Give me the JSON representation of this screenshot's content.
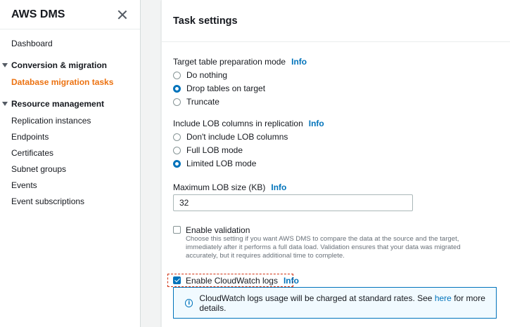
{
  "sidebar": {
    "title": "AWS DMS",
    "dashboard": "Dashboard",
    "section_conversion": "Conversion & migration",
    "db_migration_tasks": "Database migration tasks",
    "section_resource": "Resource management",
    "items": [
      "Replication instances",
      "Endpoints",
      "Certificates",
      "Subnet groups",
      "Events",
      "Event subscriptions"
    ]
  },
  "panel": {
    "title": "Task settings",
    "target_prep": {
      "label": "Target table preparation mode",
      "info": "Info",
      "options": [
        "Do nothing",
        "Drop tables on target",
        "Truncate"
      ],
      "selected": "Drop tables on target"
    },
    "lob": {
      "label": "Include LOB columns in replication",
      "info": "Info",
      "options": [
        "Don't include LOB columns",
        "Full LOB mode",
        "Limited LOB mode"
      ],
      "selected": "Limited LOB mode"
    },
    "max_lob": {
      "label": "Maximum LOB size (KB)",
      "info": "Info",
      "value": "32"
    },
    "validation": {
      "label": "Enable validation",
      "checked": false,
      "description": "Choose this setting if you want AWS DMS to compare the data at the source and the target, immediately after it performs a full data load. Validation ensures that your data was migrated accurately, but it requires additional time to complete."
    },
    "cloudwatch": {
      "label": "Enable CloudWatch logs",
      "info": "Info",
      "checked": true
    },
    "alert": {
      "icon": "info-circle-icon",
      "text_before": "CloudWatch logs usage will be charged at standard rates. See ",
      "link": "here",
      "text_after": " for more details."
    }
  },
  "colors": {
    "accent_orange": "#ec7211",
    "link_blue": "#0073bb",
    "highlight_red": "#d13212"
  }
}
